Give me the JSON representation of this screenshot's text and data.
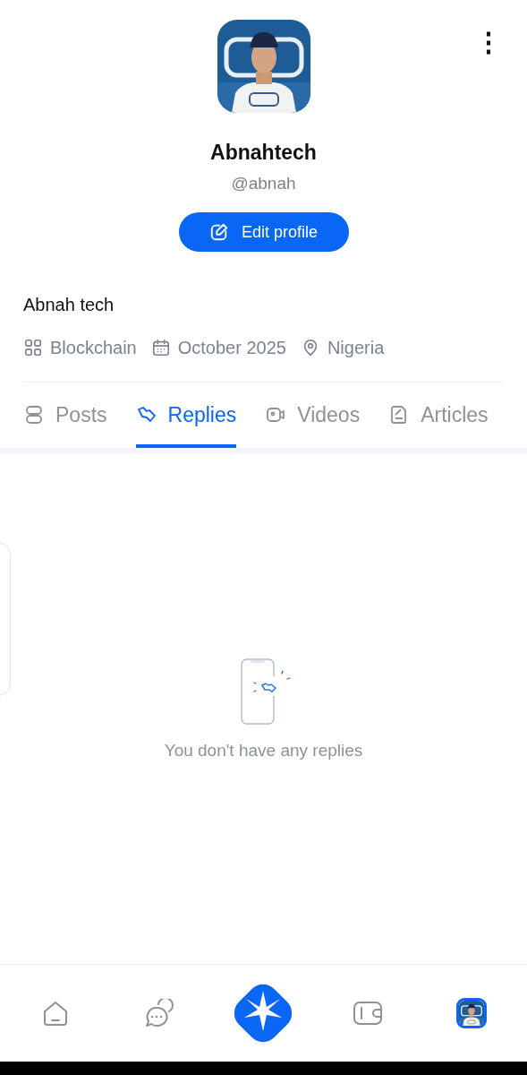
{
  "header": {
    "menu_icon": "⋮"
  },
  "profile": {
    "name": "Abnahtech",
    "handle": "@abnah",
    "edit_button": "Edit profile",
    "bio": "Abnah tech",
    "meta": [
      {
        "kind": "category",
        "text": "Blockchain"
      },
      {
        "kind": "joined",
        "text": "October 2025"
      },
      {
        "kind": "location",
        "text": "Nigeria"
      }
    ]
  },
  "tabs": [
    {
      "label": "Posts",
      "selected": false
    },
    {
      "label": "Replies",
      "selected": true
    },
    {
      "label": "Videos",
      "selected": false
    },
    {
      "label": "Articles",
      "selected": false
    }
  ],
  "empty_state": {
    "message": "You don't have any replies"
  },
  "bottom_nav": [
    {
      "kind": "home",
      "selected": false
    },
    {
      "kind": "chats",
      "selected": false
    },
    {
      "kind": "create",
      "selected": false
    },
    {
      "kind": "wallet",
      "selected": false
    },
    {
      "kind": "profile",
      "selected": true
    }
  ]
}
